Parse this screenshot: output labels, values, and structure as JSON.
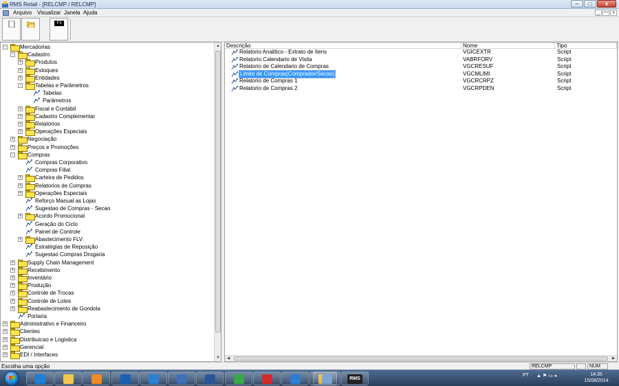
{
  "window": {
    "title": "RMS Retail - [RELCMP / RELCMP]",
    "minimize": "–",
    "maximize": "□",
    "close": "x"
  },
  "menu": {
    "items": [
      "Arquivo",
      "Visualizar",
      "Janela",
      "Ajuda"
    ],
    "mdi_controls": [
      "_",
      "ꟷ",
      "x"
    ]
  },
  "toolbar": {
    "buttons": [
      {
        "name": "new-icon",
        "label": ""
      },
      {
        "name": "open-folder-icon",
        "label": ""
      },
      {
        "name": "f3-key-icon",
        "label": "F3"
      }
    ]
  },
  "tree": {
    "items": [
      {
        "label": "Mercadorias",
        "level": 0,
        "expander": "-",
        "icon": "folder"
      },
      {
        "label": "Cadastro",
        "level": 1,
        "expander": "-",
        "icon": "folder"
      },
      {
        "label": "Produtos",
        "level": 2,
        "expander": "+",
        "icon": "folder"
      },
      {
        "label": "Estoques",
        "level": 2,
        "expander": "+",
        "icon": "folder"
      },
      {
        "label": "Entidades",
        "level": 2,
        "expander": "+",
        "icon": "folder"
      },
      {
        "label": "Tabelas e Parâmetros",
        "level": 2,
        "expander": "-",
        "icon": "folder"
      },
      {
        "label": "Tabelas",
        "level": 3,
        "expander": "",
        "icon": "script"
      },
      {
        "label": "Parâmetros",
        "level": 3,
        "expander": "",
        "icon": "script"
      },
      {
        "label": "Fiscal e Contábil",
        "level": 2,
        "expander": "+",
        "icon": "folder"
      },
      {
        "label": "Cadastro Complementar",
        "level": 2,
        "expander": "+",
        "icon": "folder"
      },
      {
        "label": "Relatórios",
        "level": 2,
        "expander": "+",
        "icon": "folder"
      },
      {
        "label": "Operações Especiais",
        "level": 2,
        "expander": "+",
        "icon": "folder"
      },
      {
        "label": "Negociação",
        "level": 1,
        "expander": "+",
        "icon": "folder"
      },
      {
        "label": "Preços e Promoções",
        "level": 1,
        "expander": "+",
        "icon": "folder"
      },
      {
        "label": "Compras",
        "level": 1,
        "expander": "-",
        "icon": "folder"
      },
      {
        "label": "Compras Corporativo",
        "level": 2,
        "expander": "",
        "icon": "script"
      },
      {
        "label": "Compras Filial",
        "level": 2,
        "expander": "",
        "icon": "script"
      },
      {
        "label": "Carteira de Pedidos",
        "level": 2,
        "expander": "+",
        "icon": "folder"
      },
      {
        "label": "Relatorios de Compras",
        "level": 2,
        "expander": "+",
        "icon": "folder-open"
      },
      {
        "label": "Operações Especiais",
        "level": 2,
        "expander": "+",
        "icon": "folder"
      },
      {
        "label": "Reforço Manual as Lojas",
        "level": 2,
        "expander": "",
        "icon": "script"
      },
      {
        "label": "Sugestao de Compras - Secao",
        "level": 2,
        "expander": "",
        "icon": "script"
      },
      {
        "label": "Acordo Promocional",
        "level": 2,
        "expander": "+",
        "icon": "folder"
      },
      {
        "label": "Geração do Ciclo",
        "level": 2,
        "expander": "",
        "icon": "script"
      },
      {
        "label": "Painel de Controle",
        "level": 2,
        "expander": "",
        "icon": "script"
      },
      {
        "label": "Abastecimento FLV",
        "level": 2,
        "expander": "+",
        "icon": "folder"
      },
      {
        "label": "Estratégias de Reposição",
        "level": 2,
        "expander": "",
        "icon": "script"
      },
      {
        "label": "Sugestao Compras Drogaria",
        "level": 2,
        "expander": "",
        "icon": "script"
      },
      {
        "label": "Supply Chain Management",
        "level": 1,
        "expander": "+",
        "icon": "folder"
      },
      {
        "label": "Recebimento",
        "level": 1,
        "expander": "+",
        "icon": "folder"
      },
      {
        "label": "Inventário",
        "level": 1,
        "expander": "+",
        "icon": "folder"
      },
      {
        "label": "Produção",
        "level": 1,
        "expander": "+",
        "icon": "folder"
      },
      {
        "label": "Controle de Trocas",
        "level": 1,
        "expander": "+",
        "icon": "folder"
      },
      {
        "label": "Controle de Lotes",
        "level": 1,
        "expander": "+",
        "icon": "folder"
      },
      {
        "label": "Reabastecimento de Gondola",
        "level": 1,
        "expander": "+",
        "icon": "folder"
      },
      {
        "label": "Portaria",
        "level": 1,
        "expander": "",
        "icon": "script"
      },
      {
        "label": "Administrativo e Financeiro",
        "level": 0,
        "expander": "+",
        "icon": "folder"
      },
      {
        "label": "Clientes",
        "level": 0,
        "expander": "+",
        "icon": "folder"
      },
      {
        "label": "Distribuicao e Logistica",
        "level": 0,
        "expander": "+",
        "icon": "folder"
      },
      {
        "label": "Gerencial",
        "level": 0,
        "expander": "+",
        "icon": "folder"
      },
      {
        "label": "EDI / Interfaces",
        "level": 0,
        "expander": "+",
        "icon": "folder"
      }
    ]
  },
  "list": {
    "columns": [
      "Descrição",
      "Nome",
      "Tipo"
    ],
    "rows": [
      {
        "descricao": "Relatorio Analitico - Extrato de Itens",
        "nome": "VGICEXTR",
        "tipo": "Script",
        "selected": false
      },
      {
        "descricao": "Relatorio Calendario de Visita",
        "nome": "VABRFORV",
        "tipo": "Script",
        "selected": false
      },
      {
        "descricao": "Relatorio de Calendario de Compras",
        "nome": "VGCRESUF",
        "tipo": "Script",
        "selected": false
      },
      {
        "descricao": "Limite de Compras(Comprador/Secao)",
        "nome": "VGCMLIMI",
        "tipo": "Script",
        "selected": true
      },
      {
        "descricao": "Relatorio de Compras 1",
        "nome": "VGCRCRPZ",
        "tipo": "Script",
        "selected": false
      },
      {
        "descricao": "Relatorio de Compras 2",
        "nome": "VGCRPDEN",
        "tipo": "Script",
        "selected": false
      }
    ]
  },
  "status": {
    "message": "Escolha uma opção",
    "program": "RELCMP",
    "numlock": "NUM"
  },
  "taskbar": {
    "apps": [
      {
        "name": "internet-explorer-icon",
        "color": "#1e7fd6"
      },
      {
        "name": "file-explorer-icon",
        "color": "#f2c94c"
      },
      {
        "name": "media-player-icon",
        "color": "#f08a24"
      },
      {
        "name": "outlook-icon",
        "color": "#1b5fb3"
      },
      {
        "name": "lync-icon",
        "color": "#2a7fd4"
      },
      {
        "name": "connector-icon",
        "color": "#3f6fb5"
      },
      {
        "name": "word-icon",
        "color": "#2b5797"
      },
      {
        "name": "installer-icon",
        "color": "#3aa64a"
      },
      {
        "name": "pdf-reader-icon",
        "color": "#d22b2b"
      },
      {
        "name": "update-icon",
        "color": "#2f7dd1"
      },
      {
        "name": "messenger-icon",
        "color": "#e0b63a"
      },
      {
        "name": "app-window-icon",
        "color": "#7da6cf"
      },
      {
        "name": "rms-icon",
        "color": "#222222"
      }
    ],
    "rms_label": "RMS",
    "tray_text": "PT",
    "time": "14:35",
    "date": "15/08/2014"
  }
}
